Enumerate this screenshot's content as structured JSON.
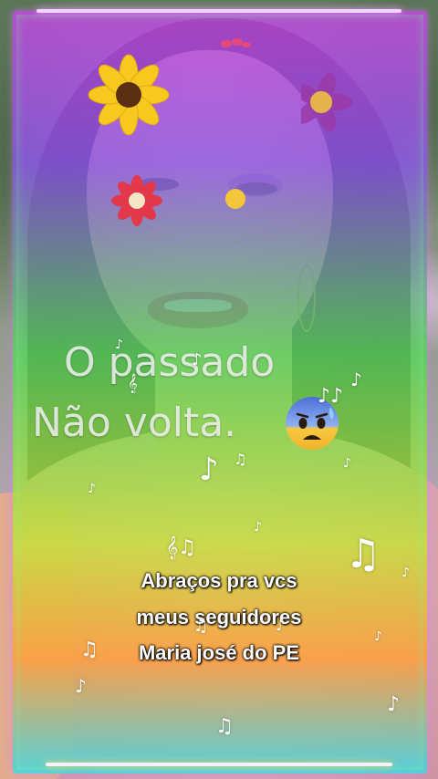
{
  "captions": {
    "line1": "O passado",
    "line2": "Não volta.",
    "greeting": [
      "Abraços  pra vcs",
      "meus seguidores",
      "Maria josé  do PE"
    ]
  },
  "stickers": {
    "flower_yellow": "sunflower-icon",
    "flower_red": "red-flower-icon",
    "emoji": "anxious-face-emoji",
    "notes": "music-note-icon"
  },
  "colors": {
    "neon_pink": "#c24be0",
    "neon_green": "#5bd35f",
    "neon_yellow": "#c7e03a",
    "neon_cyan": "#3fd9e6",
    "lipstick": "#c8283a",
    "shirt": "#e9bcc3"
  }
}
